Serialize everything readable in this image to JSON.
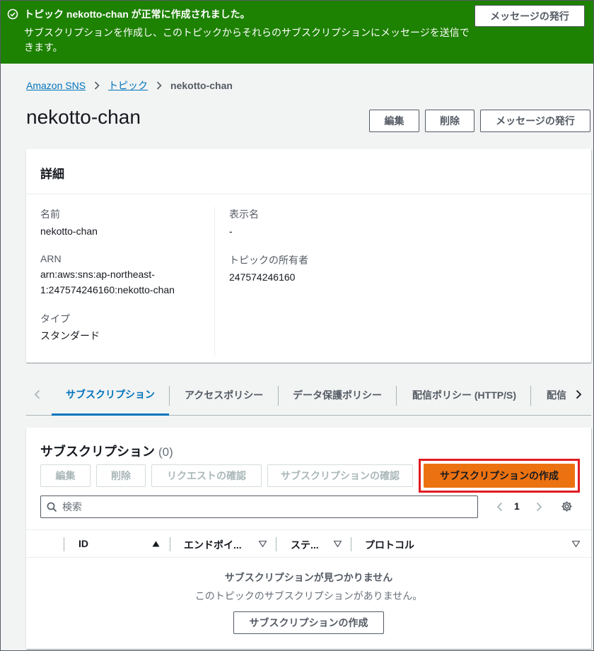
{
  "flash": {
    "title": "トピック nekotto-chan が正常に作成されました。",
    "body": "サブスクリプションを作成し、このトピックからそれらのサブスクリプションにメッセージを送信できます。",
    "button": "メッセージの発行",
    "color": "#1d8102",
    "icon": "check-circle-icon"
  },
  "breadcrumb": {
    "items": [
      "Amazon SNS",
      "トピック"
    ],
    "current": "nekotto-chan"
  },
  "header": {
    "title": "nekotto-chan",
    "buttons": [
      "編集",
      "削除",
      "メッセージの発行"
    ]
  },
  "details": {
    "heading": "詳細",
    "name_label": "名前",
    "name_value": "nekotto-chan",
    "arn_label": "ARN",
    "arn_line1": "arn:aws:sns:ap-northeast-",
    "arn_line2": "1:247574246160:nekotto-chan",
    "type_label": "タイプ",
    "type_value": "スタンダード",
    "display_label": "表示名",
    "display_value": "-",
    "owner_label": "トピックの所有者",
    "owner_value": "247574246160"
  },
  "tabs": {
    "items": [
      "サブスクリプション",
      "アクセスポリシー",
      "データ保護ポリシー",
      "配信ポリシー (HTTP/S)",
      "配信"
    ],
    "active": 0
  },
  "subscriptions": {
    "title": "サブスクリプション",
    "count": "(0)",
    "actions": [
      "編集",
      "削除",
      "リクエストの確認",
      "サブスクリプションの確認"
    ],
    "create_button": "サブスクリプションの作成",
    "search_placeholder": "検索",
    "page": "1",
    "columns": [
      "ID",
      "エンドポイ...",
      "ステ...",
      "プロトコル"
    ],
    "empty_title": "サブスクリプションが見つかりません",
    "empty_message": "このトピックのサブスクリプションがありません。",
    "empty_button": "サブスクリプションの作成",
    "accent_color": "#ec7211",
    "highlight_color": "#e11b22"
  }
}
